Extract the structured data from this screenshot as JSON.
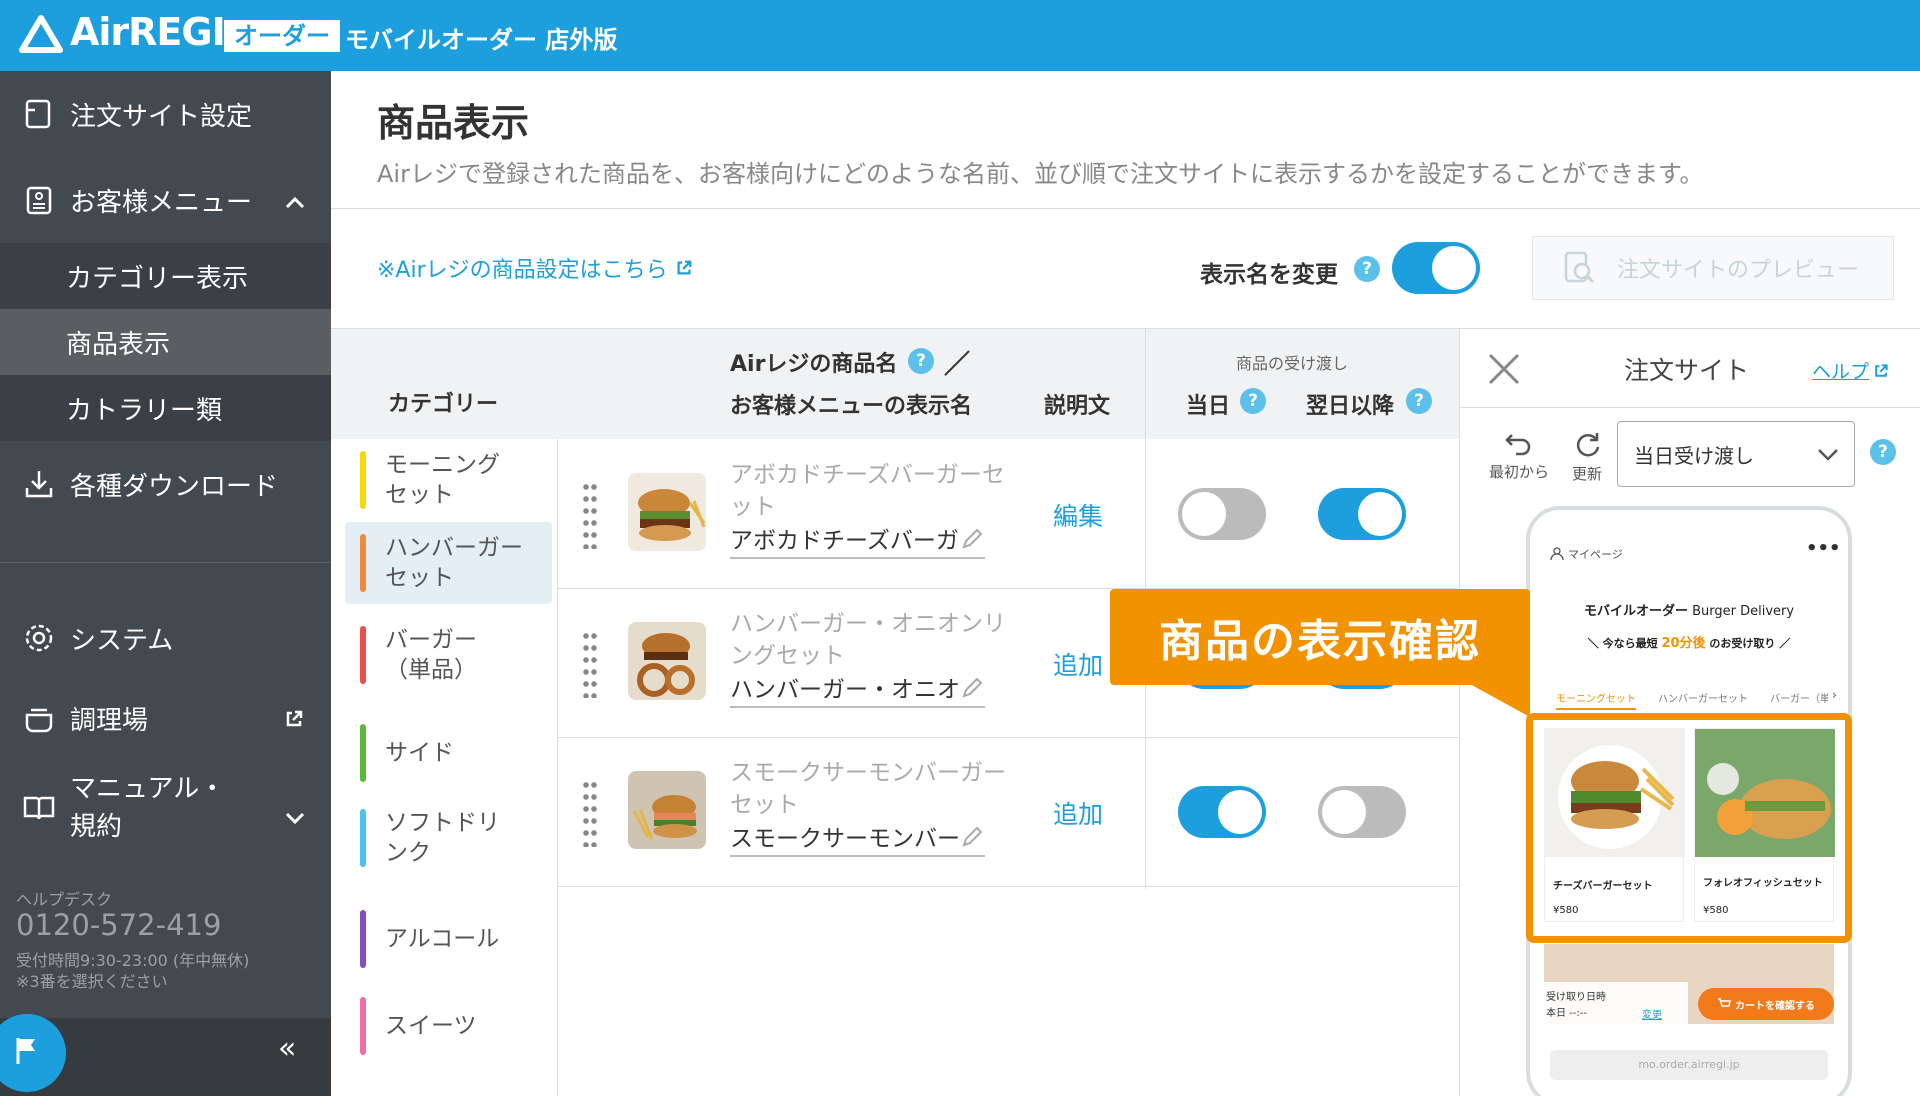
{
  "header": {
    "logo_text": "AirREGI",
    "logo_badge": "オーダー",
    "subtitle": "モバイルオーダー 店外版"
  },
  "sidebar": {
    "order_site": "注文サイト設定",
    "customer_menu": "お客様メニュー",
    "sub_items": [
      "カテゴリー表示",
      "商品表示",
      "カトラリー類"
    ],
    "downloads": "各種ダウンロード",
    "system": "システム",
    "kitchen": "調理場",
    "manual_line1": "マニュアル・",
    "manual_line2": "規約",
    "helpdesk_label": "ヘルプデスク",
    "helpdesk_phone": "0120-572-419",
    "hours": "受付時間9:30-23:00 (年中無休)",
    "note": "※3番を選択ください",
    "collapse": "«"
  },
  "main": {
    "title": "商品表示",
    "description": "Airレジで登録された商品を、お客様向けにどのような名前、並び順で注文サイトに表示するかを設定することができます。",
    "settings_link": "※Airレジの商品設定はこちら",
    "rename_label": "表示名を変更",
    "rename_on": true,
    "preview_button": "注文サイトのプレビュー"
  },
  "table": {
    "col_category": "カテゴリー",
    "col_name_line1": "Airレジの商品名",
    "col_name_slash": "／",
    "col_name_line2": "お客様メニューの表示名",
    "col_desc": "説明文",
    "col_handover": "商品の受け渡し",
    "col_today": "当日",
    "col_nextday": "翌日以降"
  },
  "categories": [
    {
      "l1": "モーニング",
      "l2": "セット",
      "color": "#f5d90a"
    },
    {
      "l1": "ハンバーガー",
      "l2": "セット",
      "color": "#f08a3c"
    },
    {
      "l1": "バーガー",
      "l2": "（単品）",
      "color": "#e8504f"
    },
    {
      "l1": "サイド",
      "l2": "",
      "color": "#5cb83c"
    },
    {
      "l1": "ソフトドリ",
      "l2": "ンク",
      "color": "#4cc3ea"
    },
    {
      "l1": "アルコール",
      "l2": "",
      "color": "#8a4cb8"
    },
    {
      "l1": "スイーツ",
      "l2": "",
      "color": "#ef6fa4"
    }
  ],
  "products": [
    {
      "name_l1": "アボカドチーズバーガーセ",
      "name_l2": "ット",
      "display": "アボカドチーズバーガ",
      "action": "編集",
      "today": false,
      "nextday": true
    },
    {
      "name_l1": "ハンバーガー・オニオンリ",
      "name_l2": "ングセット",
      "display": "ハンバーガー・オニオ",
      "action": "追加",
      "today": true,
      "nextday": true
    },
    {
      "name_l1": "スモークサーモンバーガー",
      "name_l2": "セット",
      "display": "スモークサーモンバー",
      "action": "追加",
      "today": true,
      "nextday": false
    }
  ],
  "preview": {
    "title": "注文サイト",
    "help": "ヘルプ",
    "reset": "最初から",
    "refresh": "更新",
    "select": "当日受け渡し",
    "mypage": "マイページ",
    "shop_title": "モバイルオーダー",
    "shop_sub": "Burger Delivery",
    "tagline_pre": "＼ 今なら最短",
    "tagline_min": "20分後",
    "tagline_post": "のお受け取り ／",
    "tabs": [
      "モーニングセット",
      "ハンバーガーセット",
      "バーガー（単"
    ],
    "item1_name": "チーズバーガーセット",
    "item1_price": "¥580",
    "item2_name": "フォレオフィッシュセット",
    "item2_price": "¥580",
    "pickup_label": "受け取り日時",
    "pickup_value": "本日 --:--",
    "change": "変更",
    "cart": "カートを確認する",
    "url": "mo.order.airregi.jp"
  },
  "callout": "商品の表示確認"
}
